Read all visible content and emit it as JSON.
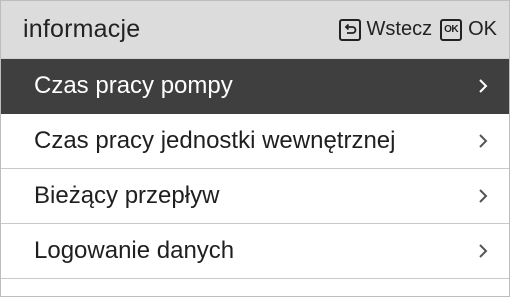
{
  "header": {
    "title": "informacje",
    "back_label": "Wstecz",
    "ok_icon_text": "OK",
    "ok_label": "OK"
  },
  "menu": {
    "items": [
      {
        "label": "Czas pracy pompy",
        "icon": "chevron-right-icon",
        "selected": true
      },
      {
        "label": "Czas pracy jednostki wewnętrznej",
        "icon": "chevron-right-icon",
        "selected": false
      },
      {
        "label": "Bieżący przepływ",
        "icon": "chevron-right-icon",
        "selected": false
      },
      {
        "label": "Logowanie danych",
        "icon": "chevron-right-icon",
        "selected": false
      }
    ]
  },
  "colors": {
    "header_bg": "#dcdcdc",
    "selected_bg": "#3f3f3f",
    "selected_text": "#ffffff",
    "text": "#1f1f1f"
  }
}
